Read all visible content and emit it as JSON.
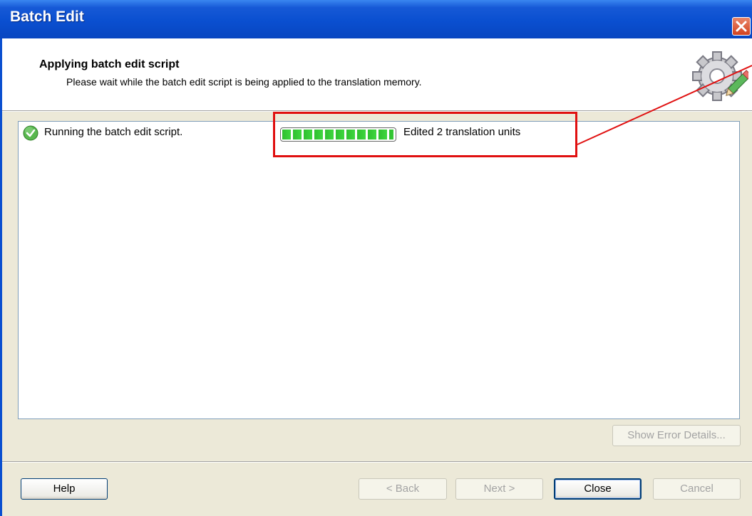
{
  "window": {
    "title": "Batch Edit"
  },
  "header": {
    "title": "Applying batch edit script",
    "subtitle": "Please wait while the batch edit script is being applied to the translation memory.",
    "icon": "gear-pencil-icon"
  },
  "task": {
    "status_icon": "check-icon",
    "label": "Running the batch edit script.",
    "progress_fraction": 1.0,
    "progress_text": "Edited 2 translation units"
  },
  "buttons": {
    "show_error_details": "Show Error Details...",
    "help": "Help",
    "back": "< Back",
    "next": "Next >",
    "close": "Close",
    "cancel": "Cancel"
  },
  "colors": {
    "titlebar": "#0a4fd0",
    "dialog_background": "#ece9d8",
    "progress_green": "#3ed63e",
    "annotation_red": "#e01010"
  }
}
